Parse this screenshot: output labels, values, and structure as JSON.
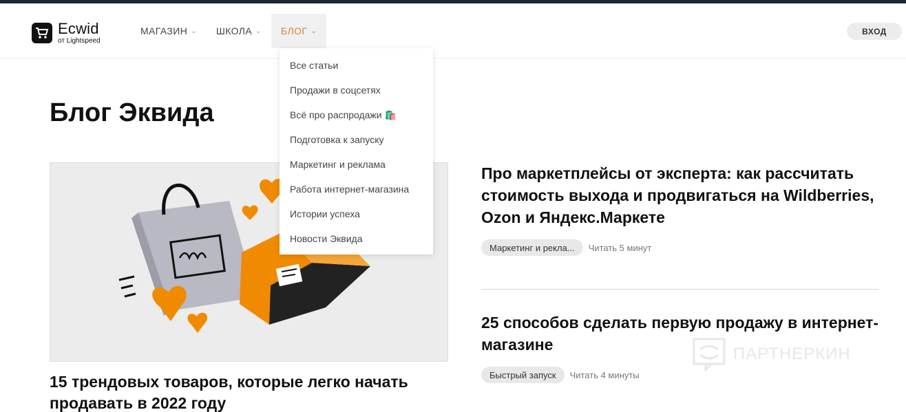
{
  "brand": {
    "name": "Ecwid",
    "sub": "от Lightspeed"
  },
  "nav": {
    "items": [
      {
        "label": "МАГАЗИН"
      },
      {
        "label": "ШКОЛА"
      },
      {
        "label": "БЛОГ",
        "active": true
      }
    ],
    "login_label": "ВХОД"
  },
  "dropdown": {
    "items": [
      "Все статьи",
      "Продажи в соцсетях",
      "Всё про распродажи 🛍️",
      "Подготовка к запуску",
      "Маркетинг и реклама",
      "Работа интернет-магазина",
      "Истории успеха",
      "Новости Эквида"
    ]
  },
  "page": {
    "title": "Блог Эквида"
  },
  "featured": {
    "title": "15 трендовых товаров, которые легко начать продавать в 2022 году"
  },
  "articles": [
    {
      "title": "Про маркетплейсы от эксперта: как рассчитать стоимость выхода и продвигаться на Wildberries, Ozon и Яндекс.Маркете",
      "tag": "Маркетинг и рекла...",
      "read_time": "Читать 5 минут"
    },
    {
      "title": "25 способов сделать первую продажу в интернет-магазине",
      "tag": "Быстрый запуск",
      "read_time": "Читать 4 минуты"
    }
  ],
  "watermark": "ПАРТНЕРКИН",
  "colors": {
    "accent": "#d9843a",
    "topbar": "#1d2733",
    "orange": "#f08a00"
  }
}
